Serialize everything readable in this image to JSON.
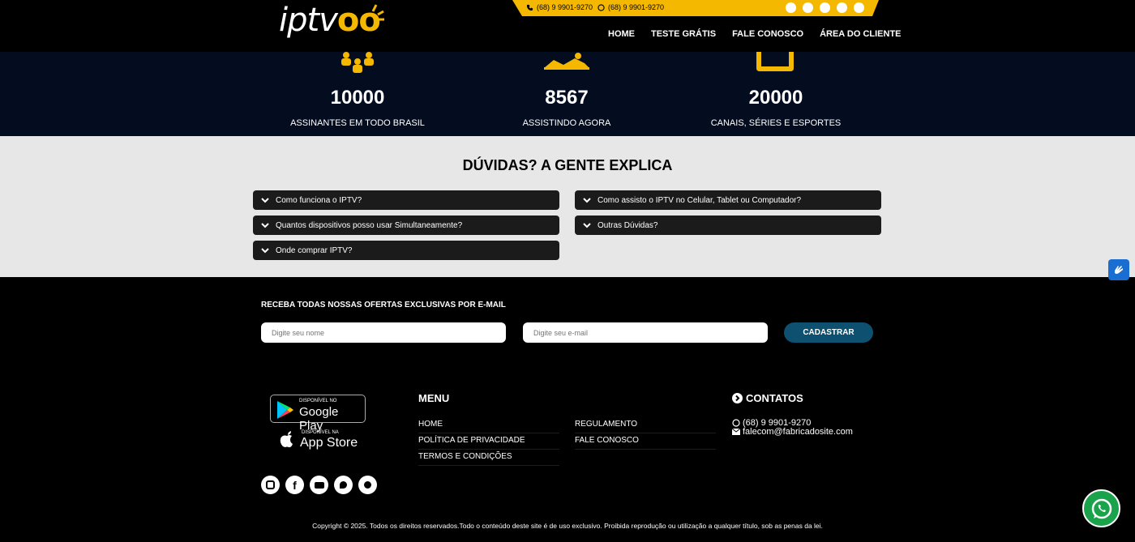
{
  "header": {
    "logo_text": "iptv",
    "logo_accent": "oo",
    "phones": [
      "(68) 9 9901-9270",
      "(68) 9 9901-9270"
    ],
    "social_icons": [
      "instagram-icon",
      "facebook-icon",
      "youtube-icon",
      "twitter-icon",
      "whatsapp-icon"
    ],
    "nav": [
      "HOME",
      "TESTE GRÁTIS",
      "FALE CONOSCO",
      "ÁREA DO CLIENTE"
    ]
  },
  "stats": [
    {
      "icon": "users-icon",
      "value": "10000",
      "label": "ASSINANTES EM TODO BRASIL"
    },
    {
      "icon": "sofa-person-icon",
      "value": "8567",
      "label": "ASSISTINDO AGORA"
    },
    {
      "icon": "tv-icon",
      "value": "20000",
      "label": "CANAIS, SÉRIES E ESPORTES"
    }
  ],
  "faq": {
    "title": "DÚVIDAS? A GENTE EXPLICA",
    "left": [
      "Como funciona o IPTV?",
      "Quantos dispositivos posso usar Simultaneamente?",
      "Onde comprar IPTV?"
    ],
    "right": [
      "Como assisto o IPTV no Celular, Tablet ou Computador?",
      "Outras Dúvidas?"
    ]
  },
  "newsletter": {
    "title": "RECEBA TODAS NOSSAS OFERTAS EXCLUSIVAS POR E-MAIL",
    "name_placeholder": "Digite seu nome",
    "email_placeholder": "Digite seu e-mail",
    "button": "CADASTRAR"
  },
  "footer": {
    "google_play_small": "DISPONÍVEL NO",
    "google_play_big": "Google Play",
    "app_store_small": "DISPONÍVEL NA",
    "app_store_big": "App Store",
    "menu_title": "MENU",
    "menu_col1": [
      "HOME",
      "POLÍTICA DE PRIVACIDADE",
      "TERMOS E CONDIÇÕES"
    ],
    "menu_col2": [
      "REGULAMENTO",
      "FALE CONOSCO"
    ],
    "contacts_title": "CONTATOS",
    "contact_phone": "(68) 9 9901-9270",
    "contact_email": "falecom@fabricadosite.com",
    "copyright": "Copyright © 2025. Todos os direitos reservados.Todo o conteúdo deste site é de uso exclusivo. Proibida reprodução ou utilização a qualquer título, sob as penas da lei."
  },
  "colors": {
    "accent": "#f5b800",
    "dark_navy": "#040c1f",
    "faq_bg": "#e7e7e7",
    "button_blue": "#0d5070",
    "whatsapp_green": "#1aa34a"
  }
}
